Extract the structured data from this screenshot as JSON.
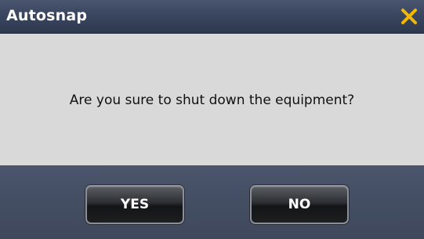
{
  "dialog": {
    "title": "Autosnap",
    "close_icon": "close-x-icon",
    "message": "Are you sure to shut down the equipment?",
    "buttons": {
      "yes_label": "YES",
      "no_label": "NO"
    }
  },
  "colors": {
    "titlebar": "#3a4660",
    "close_icon": "#f5b800",
    "body_background": "#d9d9d9",
    "footer_background": "#444e63",
    "button_background": "#1d1e20",
    "button_text": "#ffffff"
  }
}
